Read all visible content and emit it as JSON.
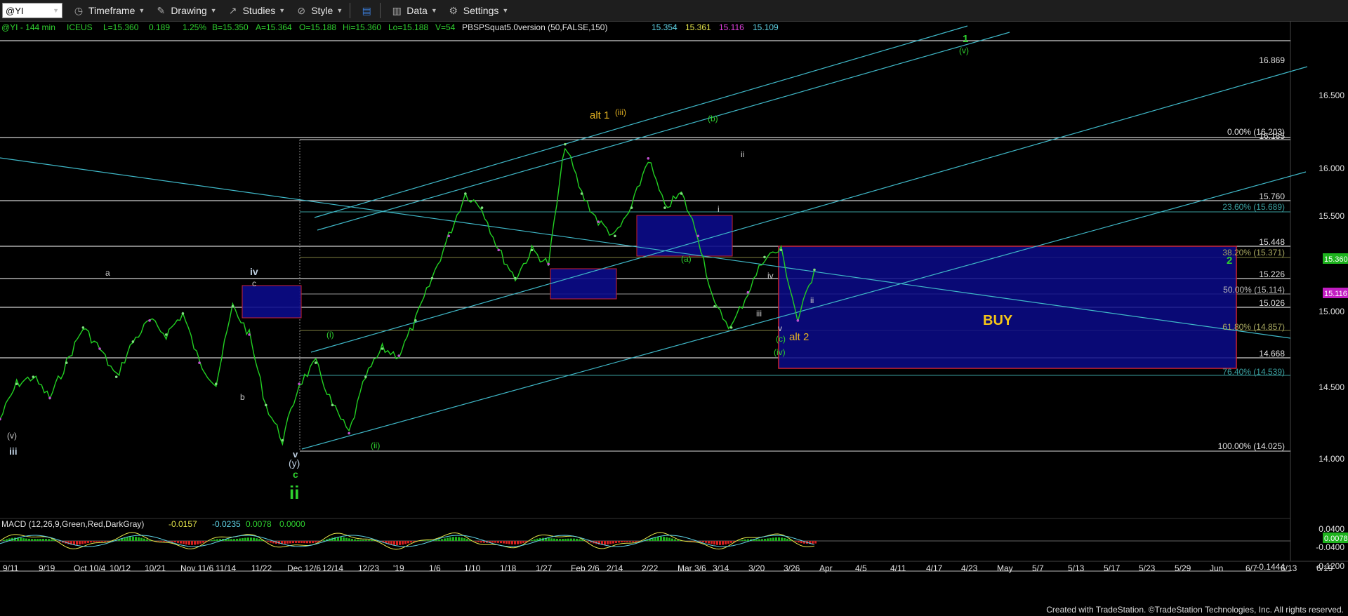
{
  "toolbar": {
    "symbol": "@YI",
    "items": [
      "Timeframe",
      "Drawing",
      "Studies",
      "Style",
      "Data",
      "Settings"
    ]
  },
  "header": {
    "symbol_info": "@YI - 144 min",
    "exchange": "ICEUS",
    "last": "L=15.360",
    "change": "0.189",
    "change_pct": "1.25%",
    "bid": "B=15.350",
    "ask": "A=15.364",
    "open": "O=15.188",
    "high": "Hi=15.360",
    "low": "Lo=15.188",
    "volume": "V=54",
    "study": "PBSPSquat5.0version (50,FALSE,150)",
    "study_values": [
      "15.354",
      "15.361",
      "15.116",
      "15.109"
    ]
  },
  "macd": {
    "label": "MACD (12,26,9,Green,Red,DarkGray)",
    "values": [
      "-0.0157",
      "-0.0235",
      "0.0078",
      "0.0000"
    ],
    "axis_ticks": [
      "0.0400",
      "-0.0400",
      "-0.1200",
      "-0.1444"
    ],
    "last_tag": "0.0078"
  },
  "price_axis": {
    "ticks": [
      "16.500",
      "16.000",
      "15.500",
      "15.000",
      "14.500",
      "14.000"
    ],
    "levels": [
      "16.869",
      "16.185",
      "15.760",
      "15.448",
      "15.226",
      "15.026",
      "14.668"
    ],
    "last_tag": "15.360",
    "study_tag": "15.116"
  },
  "fibs": [
    "0.00% (16.203)",
    "23.60% (15.689)",
    "38.20% (15.371)",
    "50.00% (15.114)",
    "61.80% (14.857)",
    "76.40% (14.539)",
    "100.00% (14.025)"
  ],
  "buy_label": "BUY",
  "wave_labels": {
    "iii_left": "iii",
    "v_left": "(v)",
    "a": "a",
    "b": "b",
    "c": "c",
    "iv": "iv",
    "v": "v",
    "y": "(y)",
    "c_green": "c",
    "ii_green": "ii",
    "i_paren": "(i)",
    "ii_paren": "(ii)",
    "alt1": "alt 1",
    "iii_paren": "(iii)",
    "b_paren": "(b)",
    "a_paren": "(a)",
    "ii": "ii",
    "i": "i",
    "iv_small": "iv",
    "iii_small": "iii",
    "v_small": "v",
    "c_paren": "(c)",
    "iv_paren": "(iv)",
    "alt2": "alt 2",
    "ii_small": "ii",
    "one": "1",
    "v_paren": "(v)",
    "two": "2"
  },
  "x_axis": [
    "9/11",
    "9/19",
    "Oct 10/4",
    "10/12",
    "10/21",
    "Nov 11/6",
    "11/14",
    "11/22",
    "Dec 12/6",
    "12/14",
    "12/23",
    "'19",
    "1/6",
    "1/10",
    "1/18",
    "1/27",
    "Feb 2/6",
    "2/14",
    "2/22",
    "Mar 3/6",
    "3/14",
    "3/20",
    "3/26",
    "Apr",
    "4/5",
    "4/11",
    "4/17",
    "4/23",
    "May",
    "5/7",
    "5/13",
    "5/17",
    "5/23",
    "5/29",
    "Jun",
    "6/7",
    "6/13",
    "6/19"
  ],
  "footer": "Created with TradeStation. ©TradeStation Technologies, Inc. All rights reserved.",
  "chart_data": {
    "type": "line",
    "title": "@YI - 144 min",
    "ylim": [
      13.7,
      17.0
    ],
    "series": [
      {
        "values": [
          14.3,
          14.55,
          14.6,
          14.45,
          14.7,
          14.95,
          14.8,
          14.6,
          14.85,
          15.0,
          14.9,
          15.05,
          14.7,
          14.55,
          15.1,
          14.9,
          14.4,
          14.15,
          14.55,
          14.7,
          14.4,
          14.2,
          14.6,
          14.8,
          14.75,
          15.0,
          15.3,
          15.6,
          15.9,
          15.8,
          15.5,
          15.3,
          15.5,
          15.4,
          16.25,
          15.9,
          15.7,
          15.6,
          15.8,
          16.15,
          15.8,
          15.9,
          15.6,
          15.1,
          14.95,
          15.2,
          15.45,
          15.5,
          15.0,
          15.36
        ]
      }
    ]
  }
}
